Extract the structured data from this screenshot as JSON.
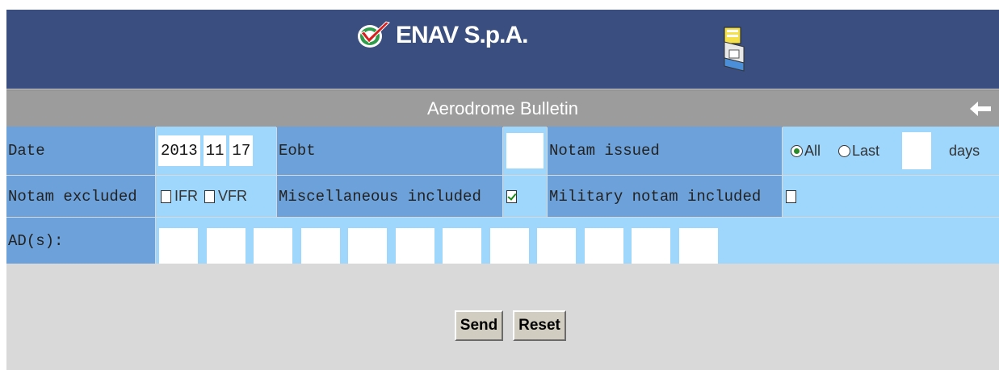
{
  "header": {
    "company": "ENAV S.p.A.",
    "logo_icon": "enav-logo-icon",
    "print_icon": "printer-icon"
  },
  "titlebar": {
    "title": "Aerodrome Bulletin",
    "back_icon": "back-arrow-icon"
  },
  "form": {
    "date_label": "Date",
    "date_year": "2013",
    "date_month": "11",
    "date_day": "17",
    "eobt_label": "Eobt",
    "eobt_value": "",
    "notam_issued_label": "Notam issued",
    "issued_all_label": "All",
    "issued_last_label": "Last",
    "issued_selected": "All",
    "last_days_value": "",
    "days_label": "days",
    "notam_excluded_label": "Notam excluded",
    "ifr_label": "IFR",
    "ifr_checked": false,
    "vfr_label": "VFR",
    "vfr_checked": false,
    "misc_label": "Miscellaneous included",
    "misc_checked": true,
    "military_label": "Military notam included",
    "military_checked": false,
    "ads_label": "AD(s):",
    "ad_values": [
      "",
      "",
      "",
      "",
      "",
      "",
      "",
      "",
      "",
      "",
      "",
      ""
    ]
  },
  "buttons": {
    "send_label": "Send",
    "reset_label": "Reset"
  },
  "colors": {
    "header_bg": "#3a4f7f",
    "titlebar_bg": "#9c9c9c",
    "label_bg": "#6da1d9",
    "value_bg": "#9fd6fb",
    "page_bg": "#d9d9d9"
  }
}
